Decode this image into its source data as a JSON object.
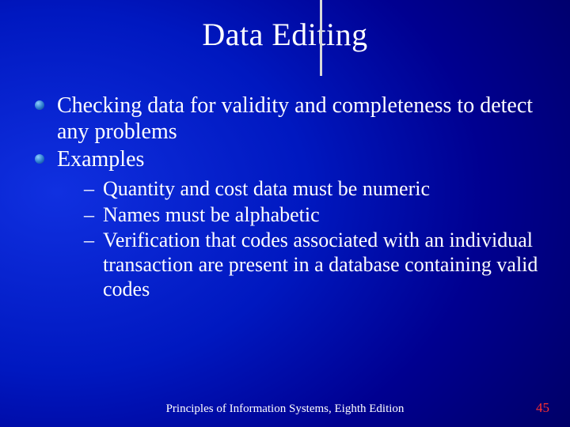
{
  "title": "Data Editing",
  "bullets": [
    {
      "text": "Checking data for validity and completeness to detect any problems"
    },
    {
      "text": "Examples"
    }
  ],
  "sub_bullets": [
    "Quantity and cost data must be numeric",
    "Names must be alphabetic",
    "Verification that codes associated with an individual transaction are present in a database containing valid codes"
  ],
  "footer": "Principles of Information Systems, Eighth Edition",
  "page_number": "45"
}
